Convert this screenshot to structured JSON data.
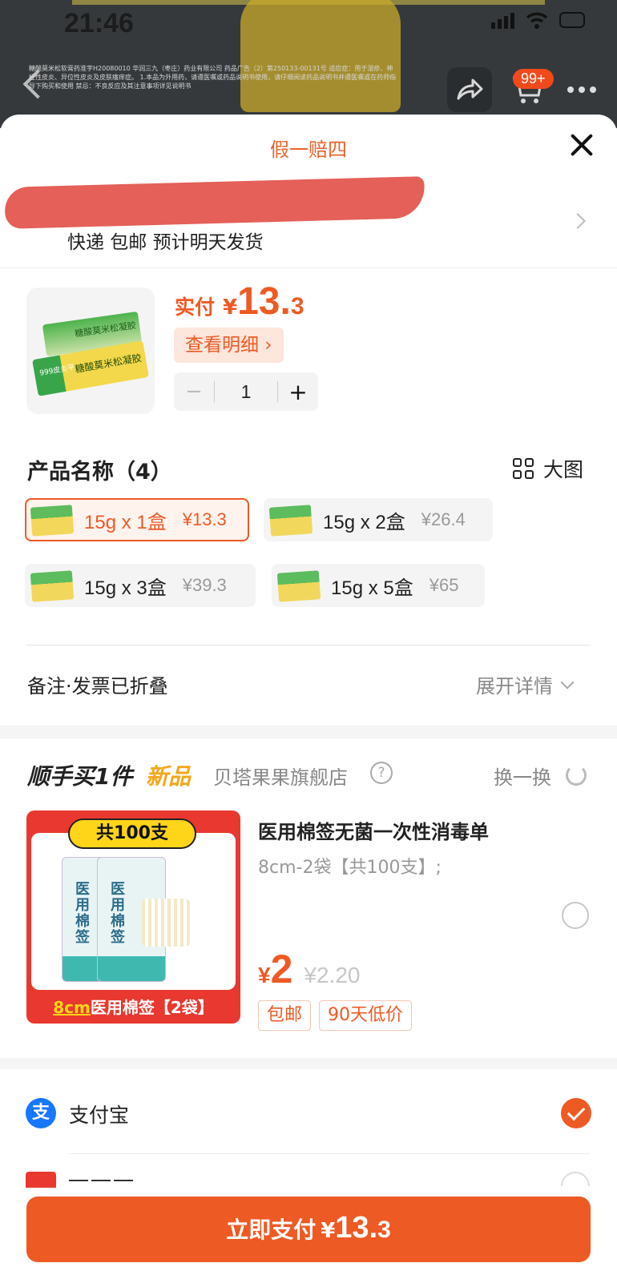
{
  "status_bar": {
    "time": "21:46"
  },
  "backdrop": {
    "small_print": "糖酸莫米松软膏药准字H20080010 华润三九（枣庄）药业有限公司 药品广告（2）第250133-00131号 适应症：用于湿疹、神经性皮炎、异位性皮炎及皮肤瘙痒症。 1.本品为外用药，请遵医嘱或药品说明书使用，请仔细阅读药品说明书并遵医嘱或在药师指导下购买和使用 禁忌：不良反应及其注意事项详见说明书"
  },
  "header": {
    "cart_badge": "99+"
  },
  "sheet": {
    "title": "假一赔四",
    "address_sub": "快递 包邮 预计明天发货"
  },
  "product": {
    "image_text": "糖酸莫米松凝胶",
    "image_brand": "999皮炎平",
    "pay_label": "实付",
    "currency": "¥",
    "price_int": "13.",
    "price_dec": "3",
    "detail_label": "查看明细 ›",
    "quantity": "1",
    "minus": "−",
    "plus": "+"
  },
  "spec_section": {
    "title": "产品名称（4）",
    "big_image_label": "大图",
    "options": [
      {
        "spec": "15g x 1盒",
        "price": "¥13.3",
        "selected": true
      },
      {
        "spec": "15g x 2盒",
        "price": "¥26.4",
        "selected": false
      },
      {
        "spec": "15g x 3盒",
        "price": "¥39.3",
        "selected": false
      },
      {
        "spec": "15g x 5盒",
        "price": "¥65",
        "selected": false
      }
    ]
  },
  "remark": {
    "label": "备注·发票已折叠",
    "expand_label": "展开详情"
  },
  "addon": {
    "title": "顺手买1件",
    "new_label": "新品",
    "store": "贝塔果果旗舰店",
    "help": "?",
    "swap_label": "换一换",
    "image_pill": "共100支",
    "image_bag_text": "医用棉签",
    "image_bottom_highlight": "8cm",
    "image_bottom_text": "医用棉签【2袋】",
    "name": "医用棉签无菌一次性消毒单",
    "spec": "8cm-2袋【共100支】;",
    "price_currency": "¥",
    "price_now": "2",
    "price_was": "¥2.20",
    "tags": [
      "包邮",
      "90天低价"
    ]
  },
  "payment": {
    "alipay_icon": "支",
    "alipay_label": "支付宝",
    "selected": true
  },
  "pay_button": {
    "label": "立即支付",
    "currency": "¥",
    "amount_int": "13.",
    "amount_dec": "3"
  },
  "colors": {
    "accent": "#ee5a24",
    "new_tag": "#f2a71c",
    "alipay": "#1677ff"
  }
}
